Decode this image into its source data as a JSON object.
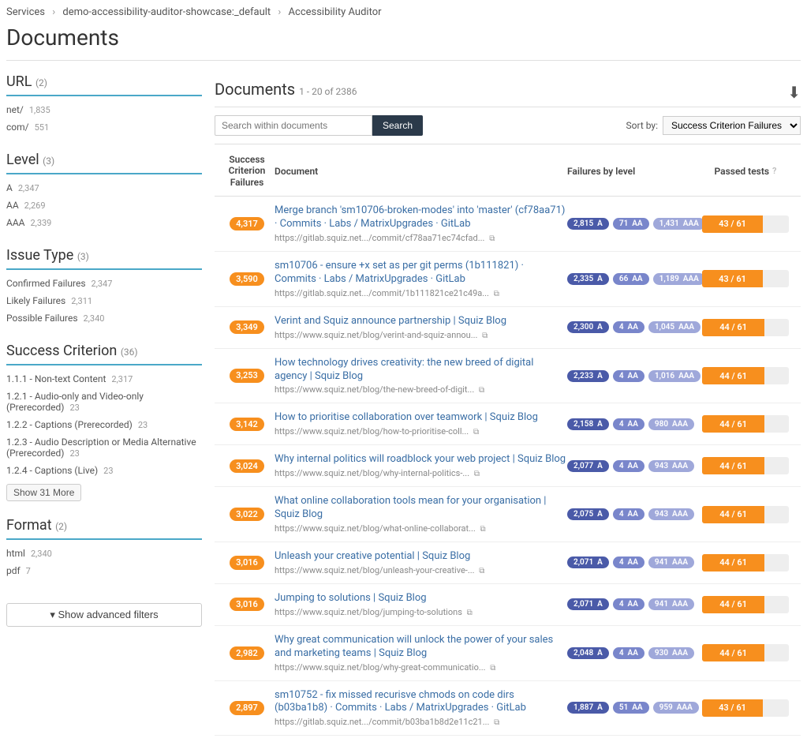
{
  "breadcrumb": [
    "Services",
    "demo-accessibility-auditor-showcase:_default",
    "Accessibility Auditor"
  ],
  "page_title": "Documents",
  "sidebar": {
    "facets": [
      {
        "title": "URL",
        "count": "(2)",
        "items": [
          {
            "label": "net/",
            "count": "1,835"
          },
          {
            "label": "com/",
            "count": "551"
          }
        ]
      },
      {
        "title": "Level",
        "count": "(3)",
        "items": [
          {
            "label": "A",
            "count": "2,347"
          },
          {
            "label": "AA",
            "count": "2,269"
          },
          {
            "label": "AAA",
            "count": "2,339"
          }
        ]
      },
      {
        "title": "Issue Type",
        "count": "(3)",
        "items": [
          {
            "label": "Confirmed Failures",
            "count": "2,347"
          },
          {
            "label": "Likely Failures",
            "count": "2,311"
          },
          {
            "label": "Possible Failures",
            "count": "2,340"
          }
        ]
      },
      {
        "title": "Success Criterion",
        "count": "(36)",
        "items": [
          {
            "label": "1.1.1 - Non-text Content",
            "count": "2,317"
          },
          {
            "label": "1.2.1 - Audio-only and Video-only (Prerecorded)",
            "count": "23"
          },
          {
            "label": "1.2.2 - Captions (Prerecorded)",
            "count": "23"
          },
          {
            "label": "1.2.3 - Audio Description or Media Alternative (Prerecorded)",
            "count": "23"
          },
          {
            "label": "1.2.4 - Captions (Live)",
            "count": "23"
          }
        ],
        "show_more": "Show 31 More"
      },
      {
        "title": "Format",
        "count": "(2)",
        "items": [
          {
            "label": "html",
            "count": "2,340"
          },
          {
            "label": "pdf",
            "count": "7"
          }
        ]
      }
    ],
    "advanced": "Show advanced filters"
  },
  "main_panel": {
    "title": "Documents",
    "range": "1 - 20 of 2386",
    "search_placeholder": "Search within documents",
    "search_btn": "Search",
    "sort_label": "Sort by:",
    "sort_value": "Success Criterion Failures",
    "columns": {
      "scf": "Success Criterion Failures",
      "doc": "Document",
      "fail": "Failures by level",
      "pass": "Passed tests"
    },
    "rows": [
      {
        "scf": "4,317",
        "title": "Merge branch 'sm10706-broken-modes' into 'master' (cf78aa71) · Commits · Labs / MatrixUpgrades · GitLab",
        "url": "https://gitlab.squiz.net.../commit/cf78aa71ec74cfad...",
        "a": "2,815",
        "aa": "71",
        "aaa": "1,431",
        "pass": "43 / 61",
        "pct": 70
      },
      {
        "scf": "3,590",
        "title": "sm10706 - ensure +x set as per git perms (1b111821) · Commits · Labs / MatrixUpgrades · GitLab",
        "url": "https://gitlab.squiz.net.../commit/1b111821ce21c49a...",
        "a": "2,335",
        "aa": "66",
        "aaa": "1,189",
        "pass": "43 / 61",
        "pct": 70
      },
      {
        "scf": "3,349",
        "title": "Verint and Squiz announce partnership | Squiz Blog",
        "url": "https://www.squiz.net/blog/verint-and-squiz-annou...",
        "a": "2,300",
        "aa": "4",
        "aaa": "1,045",
        "pass": "44 / 61",
        "pct": 72
      },
      {
        "scf": "3,253",
        "title": "How technology drives creativity: the new breed of digital agency | Squiz Blog",
        "url": "https://www.squiz.net/blog/the-new-breed-of-digit...",
        "a": "2,233",
        "aa": "4",
        "aaa": "1,016",
        "pass": "44 / 61",
        "pct": 72
      },
      {
        "scf": "3,142",
        "title": "How to prioritise collaboration over teamwork | Squiz Blog",
        "url": "https://www.squiz.net/blog/how-to-prioritise-coll...",
        "a": "2,158",
        "aa": "4",
        "aaa": "980",
        "pass": "44 / 61",
        "pct": 72
      },
      {
        "scf": "3,024",
        "title": "Why internal politics will roadblock your web project | Squiz Blog",
        "url": "https://www.squiz.net/blog/why-internal-politics-...",
        "a": "2,077",
        "aa": "4",
        "aaa": "943",
        "pass": "44 / 61",
        "pct": 72
      },
      {
        "scf": "3,022",
        "title": "What online collaboration tools mean for your organisation | Squiz Blog",
        "url": "https://www.squiz.net/blog/what-online-collaborat...",
        "a": "2,075",
        "aa": "4",
        "aaa": "943",
        "pass": "44 / 61",
        "pct": 72
      },
      {
        "scf": "3,016",
        "title": "Unleash your creative potential | Squiz Blog",
        "url": "https://www.squiz.net/blog/unleash-your-creative-...",
        "a": "2,071",
        "aa": "4",
        "aaa": "941",
        "pass": "44 / 61",
        "pct": 72
      },
      {
        "scf": "3,016",
        "title": "Jumping to solutions | Squiz Blog",
        "url": "https://www.squiz.net/blog/jumping-to-solutions",
        "a": "2,071",
        "aa": "4",
        "aaa": "941",
        "pass": "44 / 61",
        "pct": 72
      },
      {
        "scf": "2,982",
        "title": "Why great communication will unlock the power of your sales and marketing teams | Squiz Blog",
        "url": "https://www.squiz.net/blog/why-great-communicatio...",
        "a": "2,048",
        "aa": "4",
        "aaa": "930",
        "pass": "44 / 61",
        "pct": 72
      },
      {
        "scf": "2,897",
        "title": "sm10752 - fix missed recurisve chmods on code dirs (b03ba1b8) · Commits · Labs / MatrixUpgrades · GitLab",
        "url": "https://gitlab.squiz.net.../commit/b03ba1b8d2e11c21...",
        "a": "1,887",
        "aa": "51",
        "aaa": "959",
        "pass": "43 / 61",
        "pct": 70
      }
    ]
  }
}
